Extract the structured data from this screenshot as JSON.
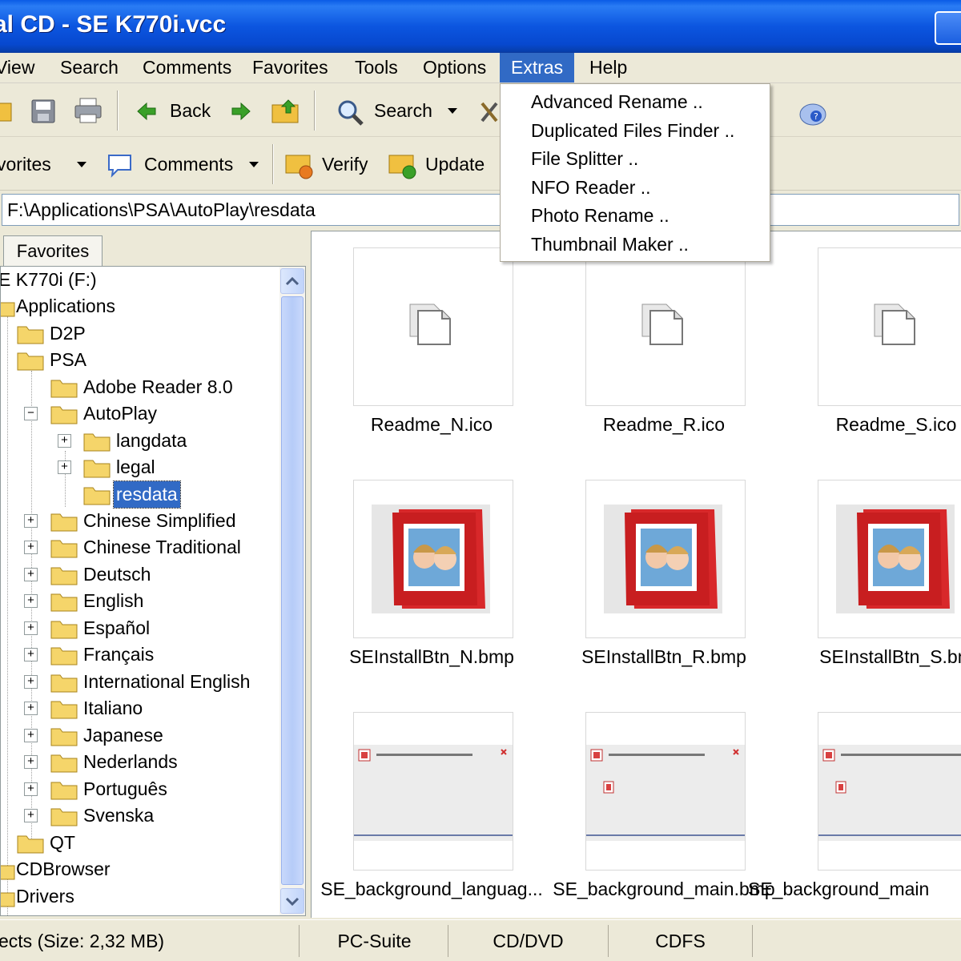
{
  "window": {
    "title": "al CD - SE K770i.vcc"
  },
  "menubar": {
    "items": [
      "View",
      "Search",
      "Comments",
      "Favorites",
      "Tools",
      "Options",
      "Extras",
      "Help"
    ],
    "active": "Extras"
  },
  "extras_menu": {
    "items": [
      "Advanced Rename ..",
      "Duplicated Files Finder ..",
      "File Splitter ..",
      "NFO Reader ..",
      "Photo Rename ..",
      "Thumbnail Maker .."
    ]
  },
  "toolbar1": {
    "back_label": "Back",
    "search_label": "Search"
  },
  "toolbar2": {
    "favorites_label": "vorites",
    "comments_label": "Comments",
    "verify_label": "Verify",
    "update_label": "Update"
  },
  "address": {
    "value": "F:\\Applications\\PSA\\AutoPlay\\resdata"
  },
  "left_panel": {
    "tab_label": "Favorites",
    "tree": [
      {
        "label": "E K770i (F:)"
      },
      {
        "label": "Applications"
      },
      {
        "label": "D2P"
      },
      {
        "label": "PSA"
      },
      {
        "label": "Adobe Reader 8.0"
      },
      {
        "label": "AutoPlay"
      },
      {
        "label": "langdata"
      },
      {
        "label": "legal"
      },
      {
        "label": "resdata",
        "selected": true
      },
      {
        "label": "Chinese Simplified"
      },
      {
        "label": "Chinese Traditional"
      },
      {
        "label": "Deutsch"
      },
      {
        "label": "English"
      },
      {
        "label": "Español"
      },
      {
        "label": "Français"
      },
      {
        "label": "International English"
      },
      {
        "label": "Italiano"
      },
      {
        "label": "Japanese"
      },
      {
        "label": "Nederlands"
      },
      {
        "label": "Português"
      },
      {
        "label": "Svenska"
      },
      {
        "label": "QT"
      },
      {
        "label": "CDBrowser"
      },
      {
        "label": "Drivers"
      }
    ]
  },
  "files": [
    {
      "name": "Readme_N.ico",
      "kind": "generic-file-icon"
    },
    {
      "name": "Readme_R.ico",
      "kind": "generic-file-icon"
    },
    {
      "name": "Readme_S.ico",
      "kind": "generic-file-icon"
    },
    {
      "name": "SEInstallBtn_N.bmp",
      "kind": "photo-album-thumbnail"
    },
    {
      "name": "SEInstallBtn_R.bmp",
      "kind": "photo-album-thumbnail"
    },
    {
      "name": "SEInstallBtn_S.bm",
      "kind": "photo-album-thumbnail"
    },
    {
      "name": "SE_background_languag...",
      "kind": "dialog-thumbnail"
    },
    {
      "name": "SE_background_main.bmp",
      "kind": "dialog-thumbnail"
    },
    {
      "name": "SE_background_main",
      "kind": "dialog-thumbnail"
    }
  ],
  "statusbar": {
    "objects": "ects (Size: 2,32 MB)",
    "suite": "PC-Suite",
    "media": "CD/DVD",
    "fs": "CDFS"
  },
  "colors": {
    "titlebar": "#0c56e0",
    "selection": "#316ac5",
    "folder": "#f5d56a",
    "album_red": "#d8282a"
  }
}
